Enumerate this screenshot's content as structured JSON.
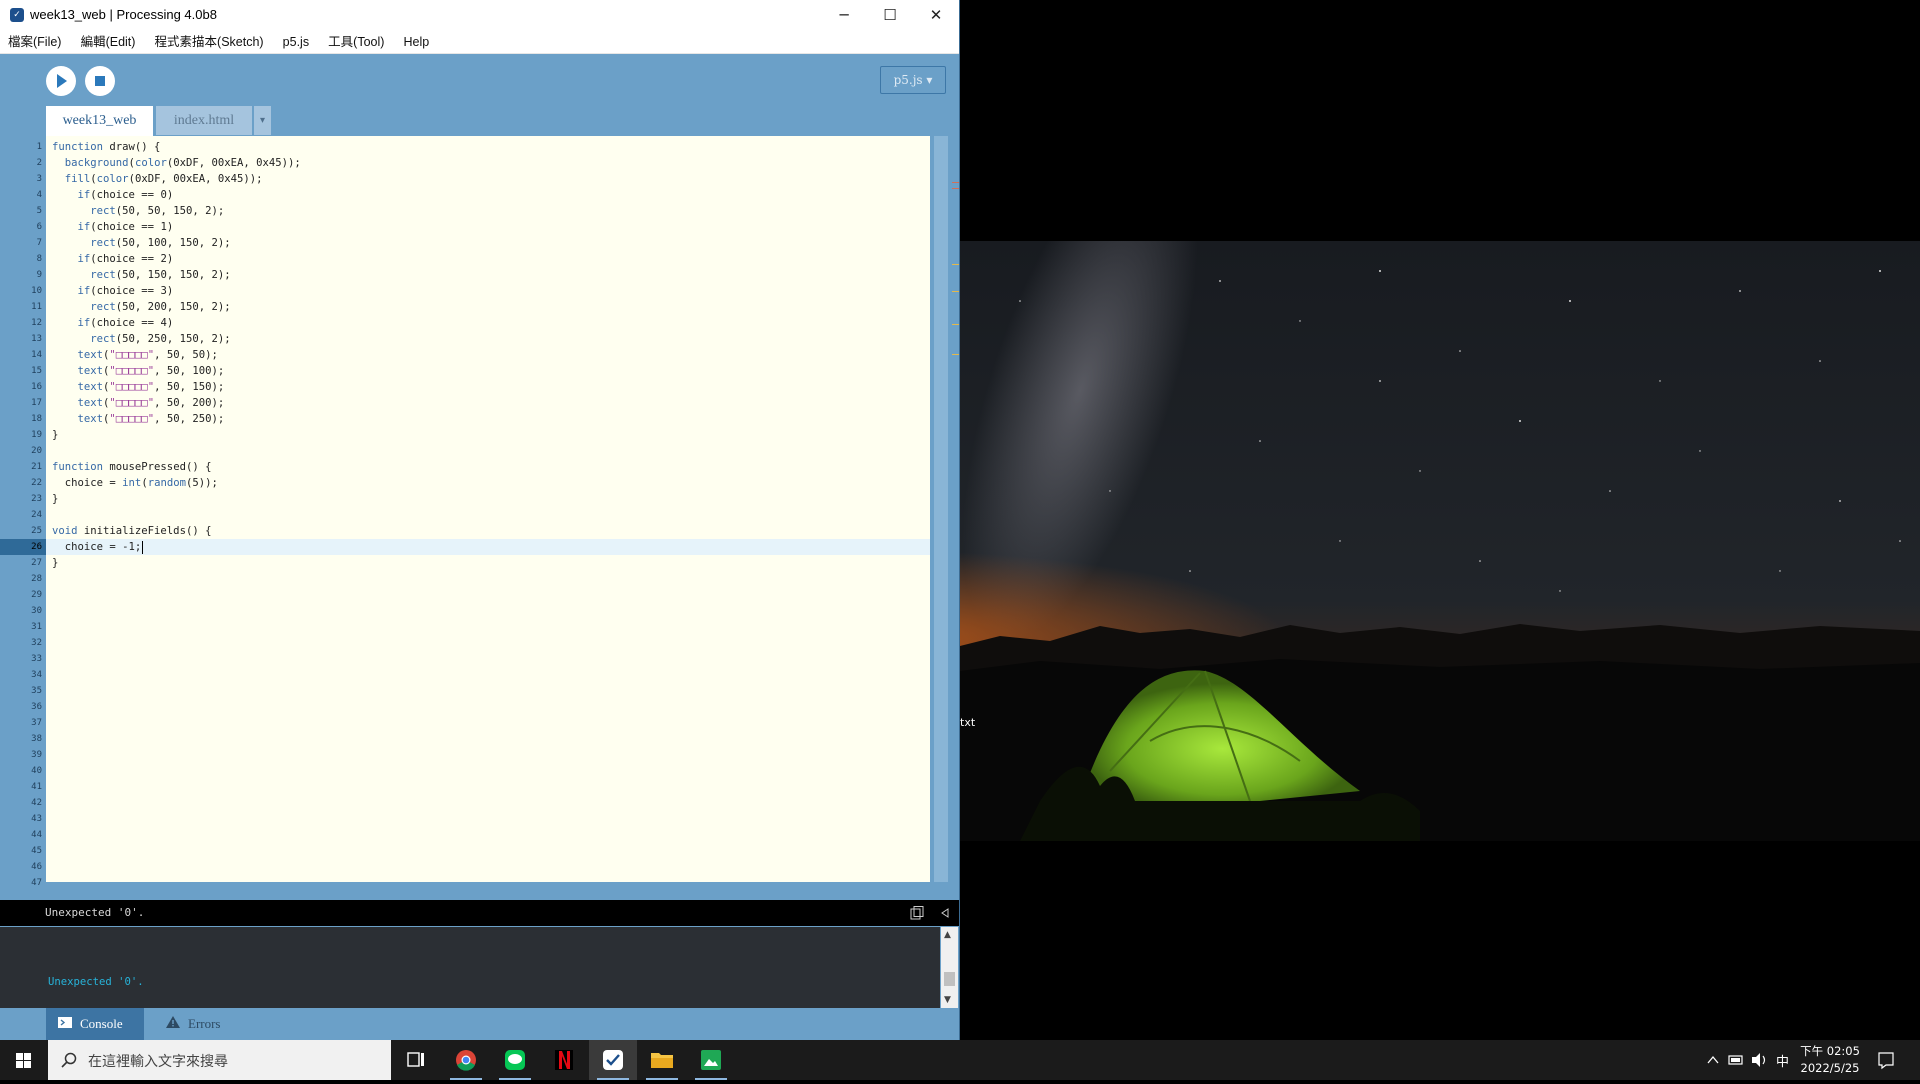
{
  "window": {
    "title": "week13_web | Processing 4.0b8",
    "app_icon_glyph": "✓",
    "minimize_glyph": "─",
    "maximize_glyph": "☐",
    "close_glyph": "✕"
  },
  "menu": [
    "檔案(File)",
    "編輯(Edit)",
    "程式素描本(Sketch)",
    "p5.js",
    "工具(Tool)",
    "Help"
  ],
  "toolbar": {
    "mode_label": "p5.js ▾"
  },
  "tabs": {
    "active": "week13_web",
    "inactive": "index.html",
    "menu_glyph": "▾"
  },
  "editor": {
    "current_line": 26,
    "line_count": 47,
    "lines": [
      "function draw() {",
      "  background(color(0xDF, 00xEA, 0x45));",
      "  fill(color(0xDF, 00xEA, 0x45));",
      "    if(choice == 0)",
      "      rect(50, 50, 150, 2);",
      "    if(choice == 1)",
      "      rect(50, 100, 150, 2);",
      "    if(choice == 2)",
      "      rect(50, 150, 150, 2);",
      "    if(choice == 3)",
      "      rect(50, 200, 150, 2);",
      "    if(choice == 4)",
      "      rect(50, 250, 150, 2);",
      "    text(\"□□□□□\", 50, 50);",
      "    text(\"□□□□□\", 50, 100);",
      "    text(\"□□□□□\", 50, 150);",
      "    text(\"□□□□□\", 50, 200);",
      "    text(\"□□□□□\", 50, 250);",
      "}",
      "",
      "function mousePressed() {",
      "  choice = int(random(5));",
      "}",
      "",
      "void initializeFields() {",
      "  choice = -1;",
      "}"
    ]
  },
  "console": {
    "status_message": "Unexpected '0'.",
    "output_line": "Unexpected '0'.",
    "tab_console": "Console",
    "tab_errors": "Errors"
  },
  "sketch": {
    "label": "txt"
  },
  "taskbar": {
    "search_placeholder": "在這裡輸入文字來搜尋",
    "clock_time": "下午 02:05",
    "clock_date": "2022/5/25",
    "ime": "中"
  },
  "colors": {
    "processing_blue": "#6ba0c8",
    "editor_bg": "#fffff0",
    "console_text": "#27b3d9",
    "tent_green": "#8fd12c"
  }
}
